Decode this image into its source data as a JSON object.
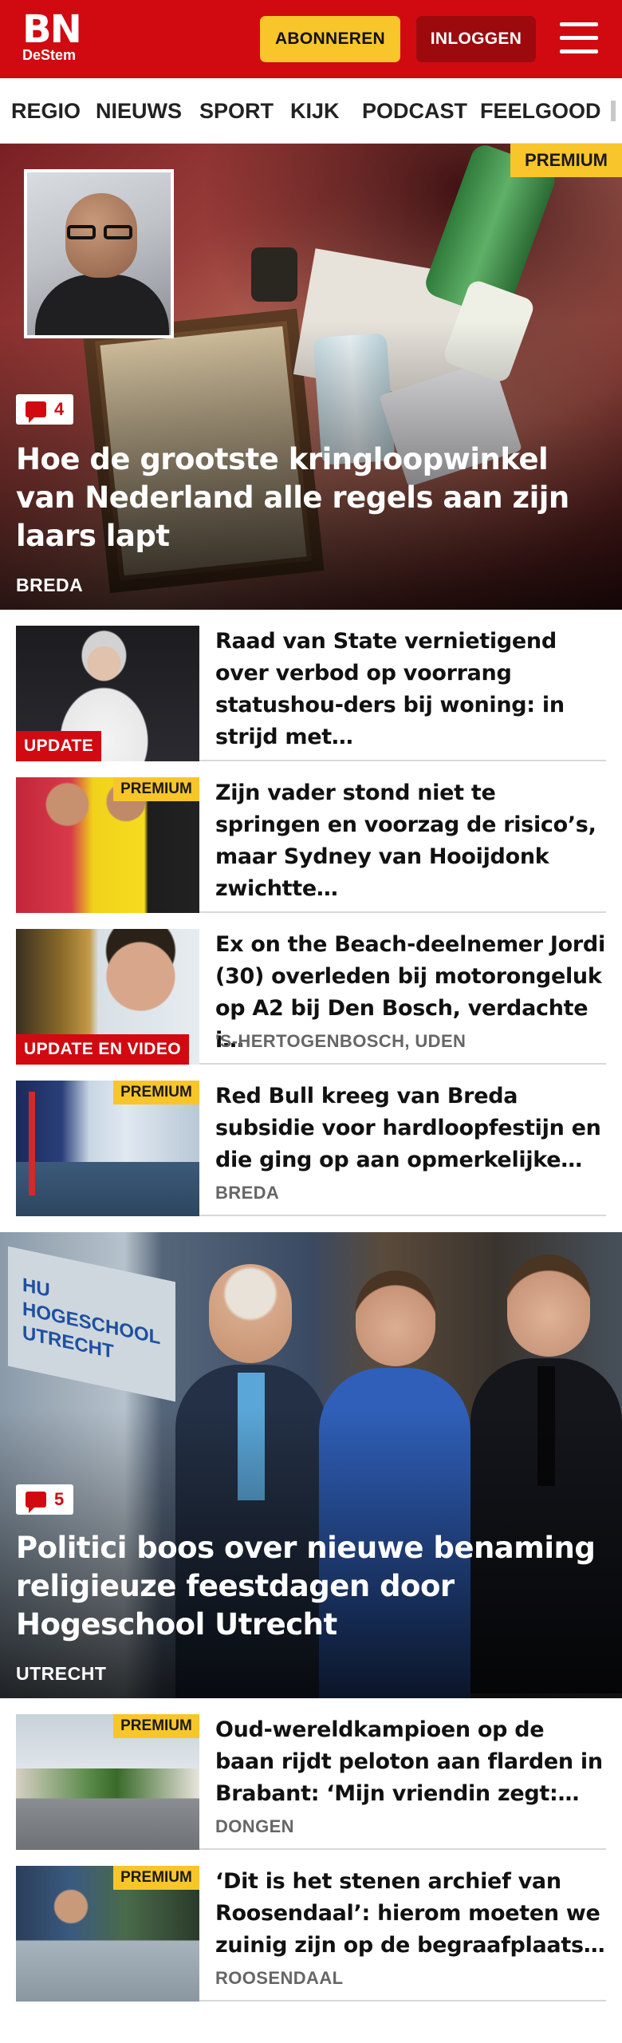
{
  "header": {
    "logo_main": "BN",
    "logo_sub": "DeStem",
    "subscribe_label": "ABONNEREN",
    "login_label": "INLOGGEN",
    "menu_icon": "hamburger-menu-icon"
  },
  "nav": {
    "items": [
      "REGIO",
      "NIEUWS",
      "SPORT",
      "KIJK",
      "PODCAST",
      "FEELGOOD"
    ]
  },
  "colors": {
    "brand_red": "#d10a11",
    "dark_red": "#9c0a0e",
    "premium_yellow": "#f8c52b"
  },
  "hero1": {
    "badge": "PREMIUM",
    "comments": "4",
    "title": "Hoe de grootste kringloopwinkel van Nederland alle regels aan zijn laars lapt",
    "location": "BREDA"
  },
  "articles1": [
    {
      "tag": "UPDATE",
      "title": "Raad van State vernietigend over verbod op voorrang statushou-ders bij woning: in strijd met…",
      "location": ""
    },
    {
      "badge": "PREMIUM",
      "title": "Zijn vader stond niet te springen en voorzag de risico’s, maar Sydney van Hooijdonk zwichtte…",
      "location": ""
    },
    {
      "tag": "UPDATE EN VIDEO",
      "title": "Ex on the Beach-deelnemer Jordi (30) overleden bij motorongeluk op A2 bij Den Bosch, verdachte i…",
      "location": "'S-HERTOGENBOSCH, UDEN"
    },
    {
      "badge": "PREMIUM",
      "title": "Red Bull kreeg van Breda subsidie voor hardloopfestijn en die ging op aan opmerkelijke…",
      "location": "BREDA"
    }
  ],
  "hero2": {
    "comments": "5",
    "title": "Politici boos over nieuwe benaming religieuze feestdagen door Hogeschool Utrecht",
    "location": "UTRECHT",
    "sign_text": "HU HOGESCHOOL UTRECHT"
  },
  "articles2": [
    {
      "badge": "PREMIUM",
      "title": "Oud-wereldkampioen op de baan rijdt peloton aan flarden in Brabant: ‘Mijn vriendin zegt:…",
      "location": "DONGEN"
    },
    {
      "badge": "PREMIUM",
      "title": "‘Dit is het stenen archief van Roosendaal’: hierom moeten we zuinig zijn op de begraafplaats…",
      "location": "ROOSENDAAL"
    }
  ]
}
